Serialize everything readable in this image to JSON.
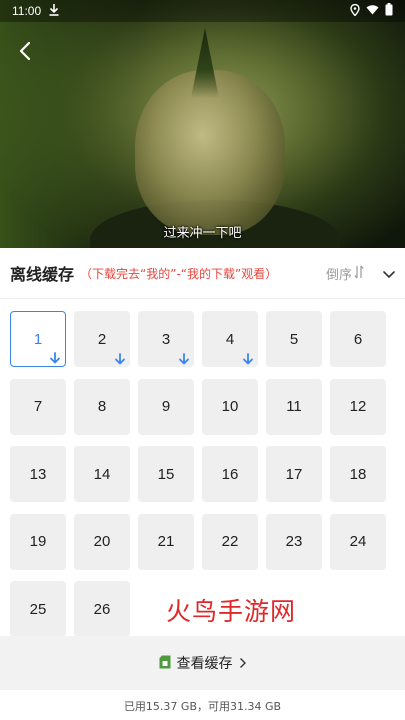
{
  "status_bar": {
    "time": "11:00"
  },
  "video": {
    "subtitle": "过来冲一下吧"
  },
  "cache": {
    "title": "离线缓存",
    "hint": "（下载完去“我的”-“我的下载”观看）",
    "sort_label": "倒序"
  },
  "episodes": [
    {
      "label": "1",
      "downloaded": true,
      "selected": true
    },
    {
      "label": "2",
      "downloaded": true,
      "selected": false
    },
    {
      "label": "3",
      "downloaded": true,
      "selected": false
    },
    {
      "label": "4",
      "downloaded": true,
      "selected": false
    },
    {
      "label": "5",
      "downloaded": false,
      "selected": false
    },
    {
      "label": "6",
      "downloaded": false,
      "selected": false
    },
    {
      "label": "7",
      "downloaded": false,
      "selected": false
    },
    {
      "label": "8",
      "downloaded": false,
      "selected": false
    },
    {
      "label": "9",
      "downloaded": false,
      "selected": false
    },
    {
      "label": "10",
      "downloaded": false,
      "selected": false
    },
    {
      "label": "11",
      "downloaded": false,
      "selected": false
    },
    {
      "label": "12",
      "downloaded": false,
      "selected": false
    },
    {
      "label": "13",
      "downloaded": false,
      "selected": false
    },
    {
      "label": "14",
      "downloaded": false,
      "selected": false
    },
    {
      "label": "15",
      "downloaded": false,
      "selected": false
    },
    {
      "label": "16",
      "downloaded": false,
      "selected": false
    },
    {
      "label": "17",
      "downloaded": false,
      "selected": false
    },
    {
      "label": "18",
      "downloaded": false,
      "selected": false
    },
    {
      "label": "19",
      "downloaded": false,
      "selected": false
    },
    {
      "label": "20",
      "downloaded": false,
      "selected": false
    },
    {
      "label": "21",
      "downloaded": false,
      "selected": false
    },
    {
      "label": "22",
      "downloaded": false,
      "selected": false
    },
    {
      "label": "23",
      "downloaded": false,
      "selected": false
    },
    {
      "label": "24",
      "downloaded": false,
      "selected": false
    },
    {
      "label": "25",
      "downloaded": false,
      "selected": false
    },
    {
      "label": "26",
      "downloaded": false,
      "selected": false
    }
  ],
  "watermark": "火鸟手游网",
  "footer": {
    "view_cache_label": "查看缓存",
    "storage_text": "已用15.37 GB，可用31.34 GB"
  },
  "colors": {
    "accent": "#3a86e8",
    "hint": "#e8453c",
    "watermark": "#e0282a",
    "tile": "#efefef"
  }
}
